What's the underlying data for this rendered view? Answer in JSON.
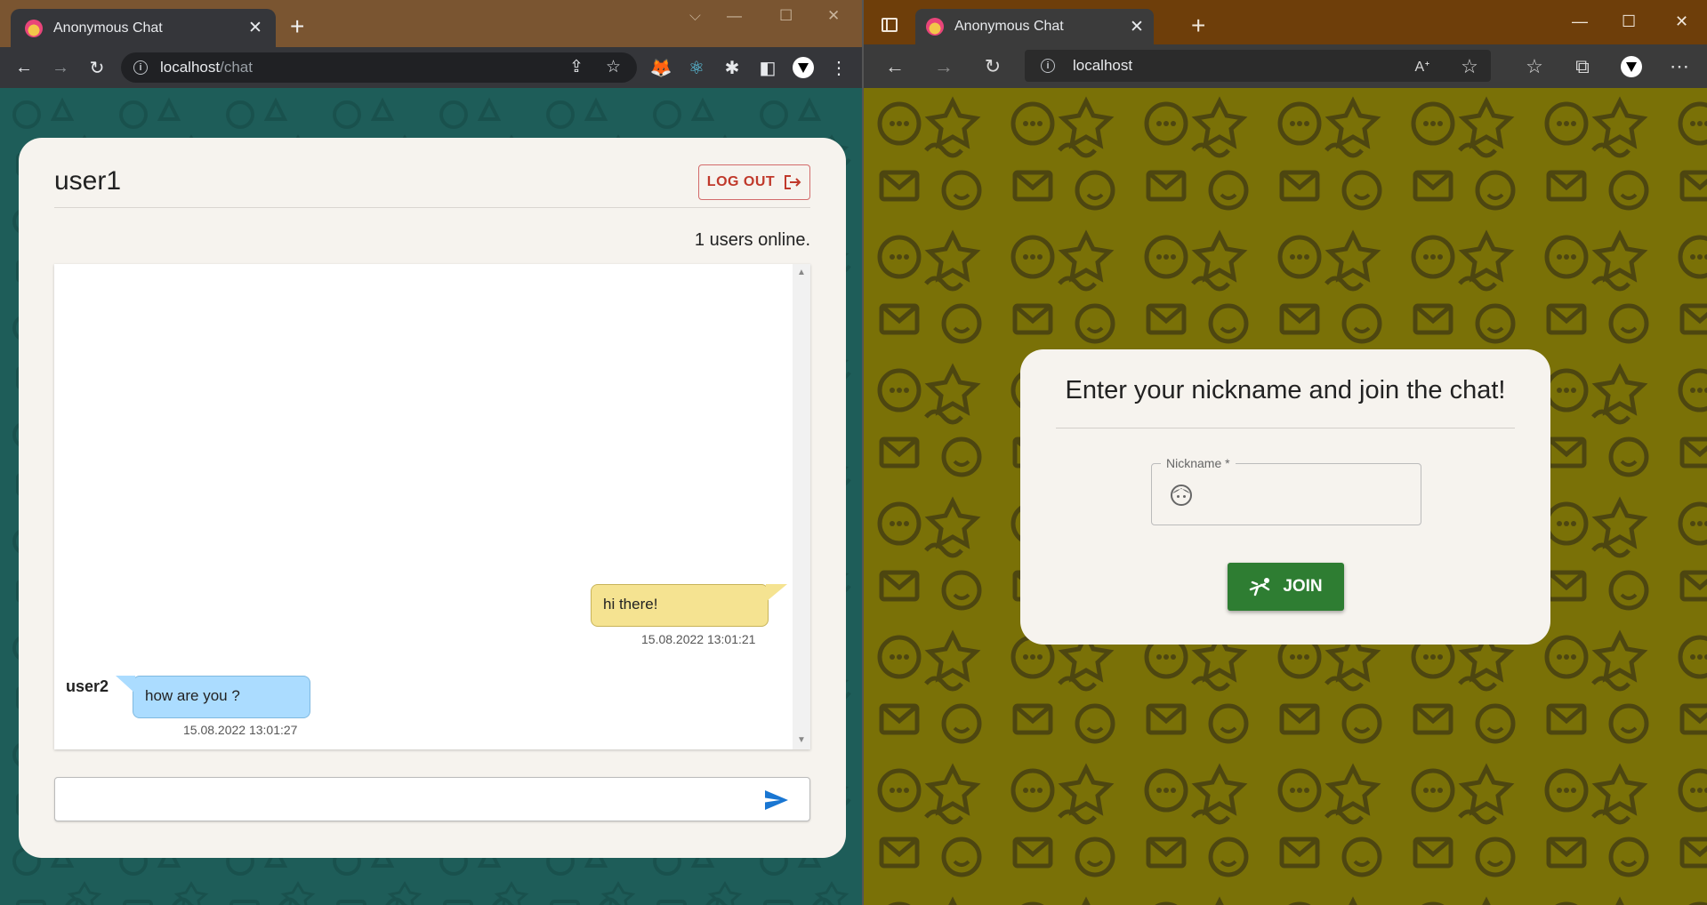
{
  "left_browser": {
    "tab_title": "Anonymous Chat",
    "url_host": "localhost",
    "url_path": "/chat",
    "tab_icon": "chat-logo-icon"
  },
  "chat": {
    "username": "user1",
    "logout_label": "LOG OUT",
    "online_text": "1 users online.",
    "messages": [
      {
        "author": "",
        "text": "hi there!",
        "timestamp": "15.08.2022 13:01:21",
        "mine": true
      },
      {
        "author": "user2",
        "text": "how are you ?",
        "timestamp": "15.08.2022 13:01:27",
        "mine": false
      }
    ],
    "input_placeholder": "",
    "colors": {
      "card": "#f6f3ee",
      "my_bubble": "#f5e391",
      "other_bubble": "#abdcff",
      "logout": "#c0392b",
      "send": "#1976d2"
    }
  },
  "right_browser": {
    "tab_title": "Anonymous Chat",
    "url_host": "localhost",
    "tab_icon": "chat-logo-icon"
  },
  "join": {
    "title": "Enter your nickname and join the chat!",
    "nickname_label": "Nickname *",
    "nickname_value": "",
    "join_label": "JOIN",
    "colors": {
      "join_button": "#2e7d32",
      "background": "#7a7107"
    }
  }
}
